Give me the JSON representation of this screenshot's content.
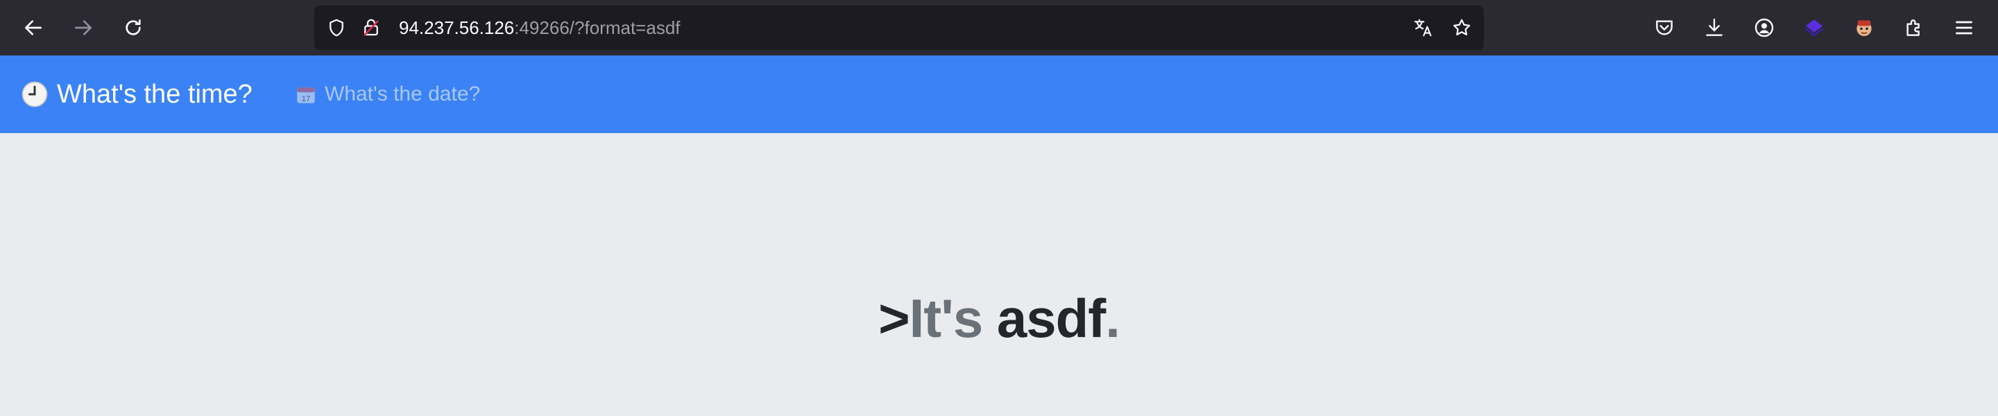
{
  "browser": {
    "url_host": "94.237.56.126",
    "url_rest": ":49266/?format=asdf",
    "icons": [
      "back-icon",
      "forward-icon",
      "reload-icon",
      "shield-icon",
      "insecure-lock-icon",
      "translate-icon",
      "bookmark-star-icon",
      "pocket-icon",
      "download-icon",
      "account-icon",
      "extension-purple-icon",
      "avatar-extension-icon",
      "extensions-puzzle-icon",
      "menu-icon"
    ]
  },
  "navbar": {
    "brand_emoji": "🕒",
    "brand_label": "What's the time?",
    "link_emoji": "📅",
    "link_label": "What's the date?",
    "bg_color": "#3b82f6"
  },
  "main": {
    "prefix": ">",
    "its": "It's",
    "value": "asdf",
    "suffix": "."
  }
}
